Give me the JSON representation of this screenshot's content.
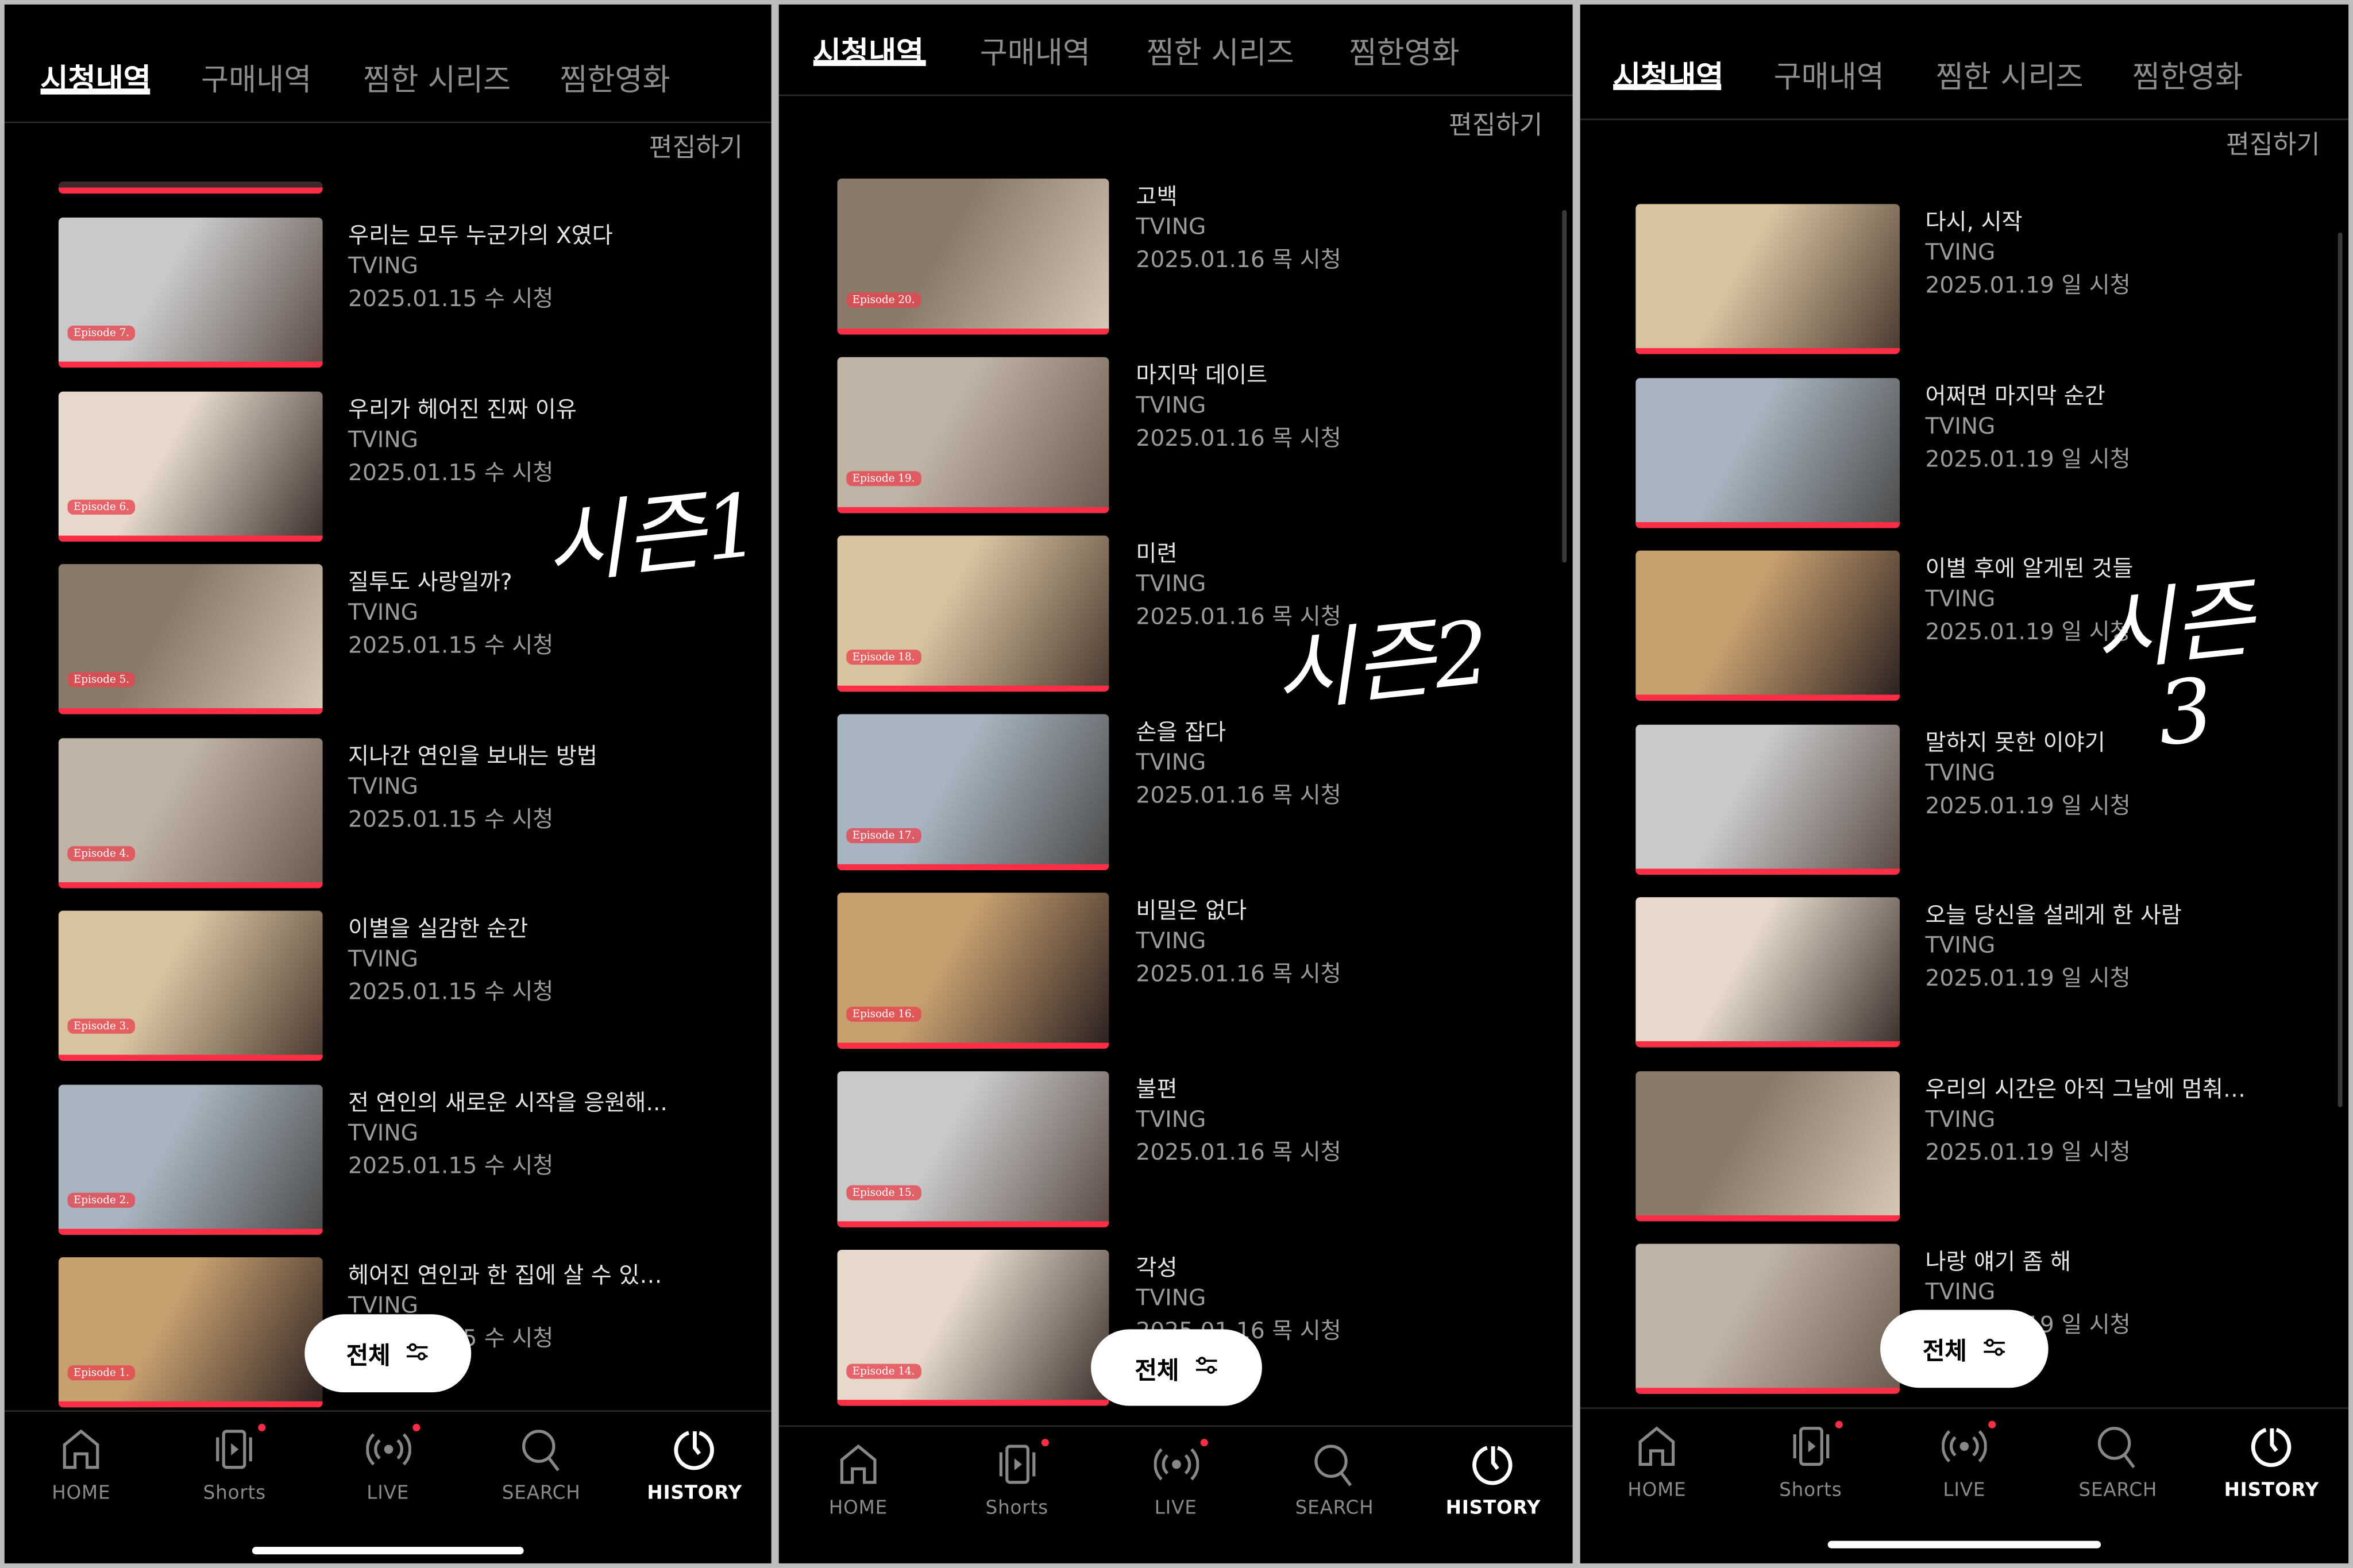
{
  "tabs": [
    "시청내역",
    "구매내역",
    "찜한 시리즈",
    "찜한영화"
  ],
  "edit_label": "편집하기",
  "filter_label": "전체",
  "nav": [
    {
      "label": "HOME",
      "icon": "home-icon",
      "badge": false
    },
    {
      "label": "Shorts",
      "icon": "shorts-icon",
      "badge": true
    },
    {
      "label": "LIVE",
      "icon": "live-icon",
      "badge": true
    },
    {
      "label": "SEARCH",
      "icon": "search-icon",
      "badge": false
    },
    {
      "label": "HISTORY",
      "icon": "history-icon",
      "badge": false,
      "active": true
    }
  ],
  "colors": {
    "accent": "#ff2d45",
    "background": "#000000"
  },
  "panels": [
    {
      "annotation": "시즌1",
      "items": [
        {
          "title": "우리는 모두 누군가의 X였다",
          "channel": "TVING",
          "date": "2025.01.15 수 시청",
          "episode": "Episode 7.",
          "progress": 1
        },
        {
          "title": "우리가 헤어진 진짜 이유",
          "channel": "TVING",
          "date": "2025.01.15 수 시청",
          "episode": "Episode 6.",
          "progress": 1
        },
        {
          "title": "질투도 사랑일까?",
          "channel": "TVING",
          "date": "2025.01.15 수 시청",
          "episode": "Episode 5.",
          "progress": 1
        },
        {
          "title": "지나간 연인을 보내는 방법",
          "channel": "TVING",
          "date": "2025.01.15 수 시청",
          "episode": "Episode 4.",
          "progress": 1
        },
        {
          "title": "이별을 실감한 순간",
          "channel": "TVING",
          "date": "2025.01.15 수 시청",
          "episode": "Episode 3.",
          "progress": 1
        },
        {
          "title": "전 연인의 새로운 시작을 응원해...",
          "channel": "TVING",
          "date": "2025.01.15 수 시청",
          "episode": "Episode 2.",
          "progress": 1
        },
        {
          "title": "헤어진 연인과 한 집에 살 수 있…",
          "channel": "TVING",
          "date": "2025.01.15 수 시청",
          "episode": "Episode 1.",
          "progress": 1
        }
      ]
    },
    {
      "annotation": "시즌2",
      "items": [
        {
          "title": "고백",
          "channel": "TVING",
          "date": "2025.01.16 목 시청",
          "episode": "Episode 20.",
          "progress": 1
        },
        {
          "title": "마지막 데이트",
          "channel": "TVING",
          "date": "2025.01.16 목 시청",
          "episode": "Episode 19.",
          "progress": 1
        },
        {
          "title": "미련",
          "channel": "TVING",
          "date": "2025.01.16 목 시청",
          "episode": "Episode 18.",
          "progress": 1
        },
        {
          "title": "손을 잡다",
          "channel": "TVING",
          "date": "2025.01.16 목 시청",
          "episode": "Episode 17.",
          "progress": 1
        },
        {
          "title": "비밀은 없다",
          "channel": "TVING",
          "date": "2025.01.16 목 시청",
          "episode": "Episode 16.",
          "progress": 1
        },
        {
          "title": "불편",
          "channel": "TVING",
          "date": "2025.01.16 목 시청",
          "episode": "Episode 15.",
          "progress": 1
        },
        {
          "title": "각성",
          "channel": "TVING",
          "date": "2025.01.16 목 시청",
          "episode": "Episode 14.",
          "progress": 1
        }
      ]
    },
    {
      "annotation": "시즌\n  3",
      "items": [
        {
          "title": "다시, 시작",
          "channel": "TVING",
          "date": "2025.01.19 일 시청",
          "episode": "",
          "progress": 1
        },
        {
          "title": "어쩌면 마지막 순간",
          "channel": "TVING",
          "date": "2025.01.19 일 시청",
          "episode": "",
          "progress": 1
        },
        {
          "title": "이별 후에 알게된 것들",
          "channel": "TVING",
          "date": "2025.01.19 일 시청",
          "episode": "",
          "progress": 1
        },
        {
          "title": "말하지 못한 이야기",
          "channel": "TVING",
          "date": "2025.01.19 일 시청",
          "episode": "",
          "progress": 1
        },
        {
          "title": "오늘 당신을 설레게 한 사람",
          "channel": "TVING",
          "date": "2025.01.19 일 시청",
          "episode": "",
          "progress": 1
        },
        {
          "title": "우리의 시간은 아직 그날에 멈춰…",
          "channel": "TVING",
          "date": "2025.01.19 일 시청",
          "episode": "",
          "progress": 1
        },
        {
          "title": "나랑 얘기 좀 해",
          "channel": "TVING",
          "date": "2025.01.19 일 시청",
          "episode": "",
          "progress": 1
        }
      ]
    }
  ]
}
